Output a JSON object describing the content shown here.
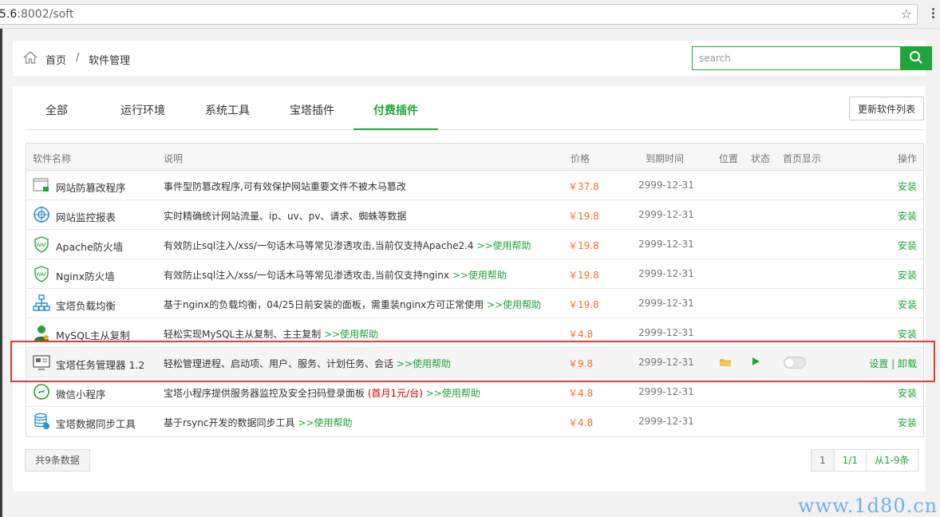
{
  "browser": {
    "url_host_tail": "5.6",
    "url_rest": ":8002/soft",
    "star_icon": "star-outline-icon",
    "menu_icon": "kebab-menu-icon"
  },
  "breadcrumb": {
    "home": "首页",
    "separator": "/",
    "current": "软件管理"
  },
  "search": {
    "placeholder": "search",
    "value": ""
  },
  "tabs": [
    {
      "label": "全部",
      "active": false
    },
    {
      "label": "运行环境",
      "active": false
    },
    {
      "label": "系统工具",
      "active": false
    },
    {
      "label": "宝塔插件",
      "active": false
    },
    {
      "label": "付费插件",
      "active": true
    }
  ],
  "update_button": "更新软件列表",
  "table": {
    "headers": {
      "name": "软件名称",
      "desc": "说明",
      "price": "价格",
      "expire": "到期时间",
      "position": "位置",
      "status": "状态",
      "home_display": "首页显示",
      "action": "操作"
    },
    "rows": [
      {
        "icon": "tamper-proof-icon",
        "name": "网站防篡改程序",
        "desc": "事件型防篡改程序,可有效保护网站重要文件不被木马篡改",
        "help": "",
        "price": "￥37.8",
        "expire": "2999-12-31",
        "action": "安装"
      },
      {
        "icon": "monitor-report-icon",
        "name": "网站监控报表",
        "desc": "实时精确统计网站流量、ip、uv、pv、请求、蜘蛛等数据",
        "help": "",
        "price": "￥19.8",
        "expire": "2999-12-31",
        "action": "安装"
      },
      {
        "icon": "waf-shield-icon",
        "name": "Apache防火墙",
        "desc": "有效防止sql注入/xss/一句话木马等常见渗透攻击,当前仅支持Apache2.4",
        "help": ">>使用帮助",
        "price": "￥19.8",
        "expire": "2999-12-31",
        "action": "安装"
      },
      {
        "icon": "waf-shield-icon",
        "name": "Nginx防火墙",
        "desc": "有效防止sql注入/xss/一句话木马等常见渗透攻击,当前仅支持nginx",
        "help": ">>使用帮助",
        "price": "￥19.8",
        "expire": "2999-12-31",
        "action": "安装"
      },
      {
        "icon": "load-balance-icon",
        "name": "宝塔负载均衡",
        "desc": "基于nginx的负载均衡，04/25日前安装的面板，需重装nginx方可正常使用",
        "help": ">>使用帮助",
        "price": "￥19.8",
        "expire": "2999-12-31",
        "action": "安装"
      },
      {
        "icon": "mysql-replication-icon",
        "name": "MySQL主从复制",
        "desc": "轻松实现MySQL主从复制、主主复制",
        "help": ">>使用帮助",
        "price": "￥4.8",
        "expire": "2999-12-31",
        "action": "安装"
      },
      {
        "icon": "task-manager-icon",
        "name": "宝塔任务管理器 1.2",
        "desc": "轻松管理进程、启动项、用户、服务、计划任务、会话",
        "help": ">>使用帮助",
        "price": "￥9.8",
        "expire": "2999-12-31",
        "installed": true,
        "action_settings": "设置",
        "action_sep": "|",
        "action_uninstall": "卸载",
        "position_icon": "folder-icon",
        "status_icon": "play-icon",
        "home_display_on": false
      },
      {
        "icon": "wechat-mini-icon",
        "name": "微信小程序",
        "desc": "宝塔小程序提供服务器监控及安全扫码登录面板",
        "note": "(首月1元/台)",
        "help": ">>使用帮助",
        "price": "￥4.8",
        "expire": "2999-12-31",
        "action": "安装"
      },
      {
        "icon": "data-sync-icon",
        "name": "宝塔数据同步工具",
        "desc": "基于rsync开发的数据同步工具",
        "help": ">>使用帮助",
        "price": "￥4.8",
        "expire": "2999-12-31",
        "action": "安装"
      }
    ]
  },
  "footer": {
    "count": "共9条数据",
    "pages": [
      "1",
      "1/1",
      "从1-9条"
    ]
  },
  "watermark": "www.1d80.cn",
  "colors": {
    "accent": "#20a53a",
    "price": "#fc6d26",
    "highlight_border": "#e53935"
  }
}
